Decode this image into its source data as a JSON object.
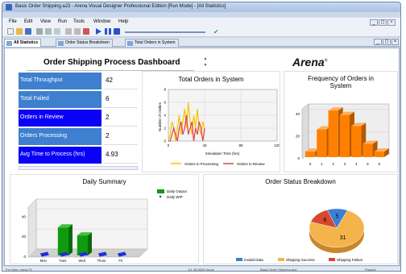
{
  "window": {
    "title": "Basic Order Shipping.a23 - Arena Visual Designer Professional Edition [Run Mode] - [All Statistics]"
  },
  "menu": [
    "File",
    "Edit",
    "View",
    "Run",
    "Tools",
    "Window",
    "Help"
  ],
  "window_buttons": [
    "_",
    "◻",
    "×"
  ],
  "inner_window_buttons": [
    "_",
    "◻",
    "×"
  ],
  "tabs": [
    {
      "label": "All Statistics",
      "active": true
    },
    {
      "label": "Order Status Breakdown",
      "active": false
    },
    {
      "label": "Total Orders in System",
      "active": false
    }
  ],
  "dashboard": {
    "title": "Order Shipping Process Dashboard",
    "logo": "Arena",
    "logo_mark": "®"
  },
  "stats": [
    {
      "label": "Total Throughput",
      "value": "42",
      "color": "#3e7fd0"
    },
    {
      "label": "Total Failed",
      "value": "6",
      "color": "#3e7fd0"
    },
    {
      "label": "Orders in Review",
      "value": "2",
      "color": "#0a00f5"
    },
    {
      "label": "Orders Processing",
      "value": "2",
      "color": "#3e7fd0"
    },
    {
      "label": "Avg Time to Process (hrs)",
      "value": "4.93",
      "color": "#0a00f5"
    }
  ],
  "charts": {
    "orders_in_system": {
      "title": "Total Orders in System",
      "xlabel": "Simulation Time (hrs)",
      "ylabel": "Number of Orders",
      "xticks": [
        "0",
        "40",
        "80",
        "120"
      ],
      "yticks": [
        "0",
        "2",
        "4",
        "6",
        "8"
      ],
      "legend": [
        "Orders in Processing",
        "Orders in Review"
      ]
    },
    "frequency": {
      "title_lines": [
        "Frequency of Orders in",
        "System"
      ],
      "xticks": [
        "0",
        "1",
        "2",
        "3",
        "4",
        "5",
        "6"
      ],
      "yticks": [
        "0",
        "20",
        "40"
      ]
    },
    "daily_summary": {
      "title": "Daily Summary",
      "categories": [
        "Mon",
        "Tues",
        "Wed",
        "Thurs",
        "Fri"
      ],
      "yticks": [
        "0",
        "20",
        "40"
      ],
      "legend": [
        "Daily Output",
        "Daily WIP"
      ]
    },
    "order_status": {
      "title": "Order Status Breakdown",
      "legend": [
        "Invalid Data",
        "Shipping Success",
        "Shipping Failure"
      ],
      "slice_labels": [
        "31",
        "6",
        "5"
      ]
    }
  },
  "chart_data": [
    {
      "type": "line",
      "title": "Total Orders in System",
      "xlabel": "Simulation Time (hrs)",
      "ylabel": "Number of Orders",
      "xlim": [
        0,
        120
      ],
      "ylim": [
        0,
        8
      ],
      "x": [
        0,
        2,
        4,
        6,
        8,
        10,
        12,
        14,
        16,
        18,
        20,
        22,
        24,
        26,
        28,
        30,
        32,
        34,
        36,
        38,
        40
      ],
      "series": [
        {
          "name": "Orders in Processing",
          "color": "#f5c400",
          "values": [
            0,
            1,
            3,
            2,
            0,
            2,
            4,
            1,
            3,
            5,
            2,
            6,
            3,
            1,
            4,
            2,
            5,
            2,
            1,
            3,
            2
          ]
        },
        {
          "name": "Orders in Review",
          "color": "#e0404a",
          "values": [
            0,
            0,
            1,
            2,
            1,
            0,
            2,
            3,
            1,
            2,
            4,
            1,
            2,
            3,
            0,
            2,
            1,
            3,
            2,
            0,
            2
          ]
        }
      ],
      "legend": "bottom"
    },
    {
      "type": "bar",
      "title": "Frequency of Orders in System",
      "categories": [
        "0",
        "1",
        "2",
        "3",
        "4",
        "5",
        "6"
      ],
      "values": [
        5,
        25,
        42,
        38,
        28,
        12,
        5
      ],
      "ylim": [
        0,
        45
      ],
      "color": "#ff8000"
    },
    {
      "type": "bar",
      "title": "Daily Summary",
      "categories": [
        "Mon",
        "Tues",
        "Wed",
        "Thurs",
        "Fri"
      ],
      "series": [
        {
          "name": "Daily Output",
          "color": "#109a10",
          "values": [
            0,
            28,
            20,
            0,
            0
          ]
        },
        {
          "name": "Daily WIP",
          "color": "#1f2ed8",
          "values": [
            2,
            2,
            2,
            2,
            2
          ]
        }
      ],
      "ylim": [
        0,
        50
      ],
      "legend": "top-right"
    },
    {
      "type": "pie",
      "title": "Order Status Breakdown",
      "categories": [
        "Shipping Success",
        "Shipping Failure",
        "Invalid Data"
      ],
      "values": [
        31,
        6,
        5
      ],
      "colors": [
        "#f5b44b",
        "#d8482e",
        "#3a7fd6"
      ],
      "legend": "bottom"
    }
  ],
  "status": {
    "help": "For Help, press F1",
    "time": "1/1   36.5000 Hours",
    "model": "Basic Order Shipping.doe",
    "state": "Paused"
  }
}
